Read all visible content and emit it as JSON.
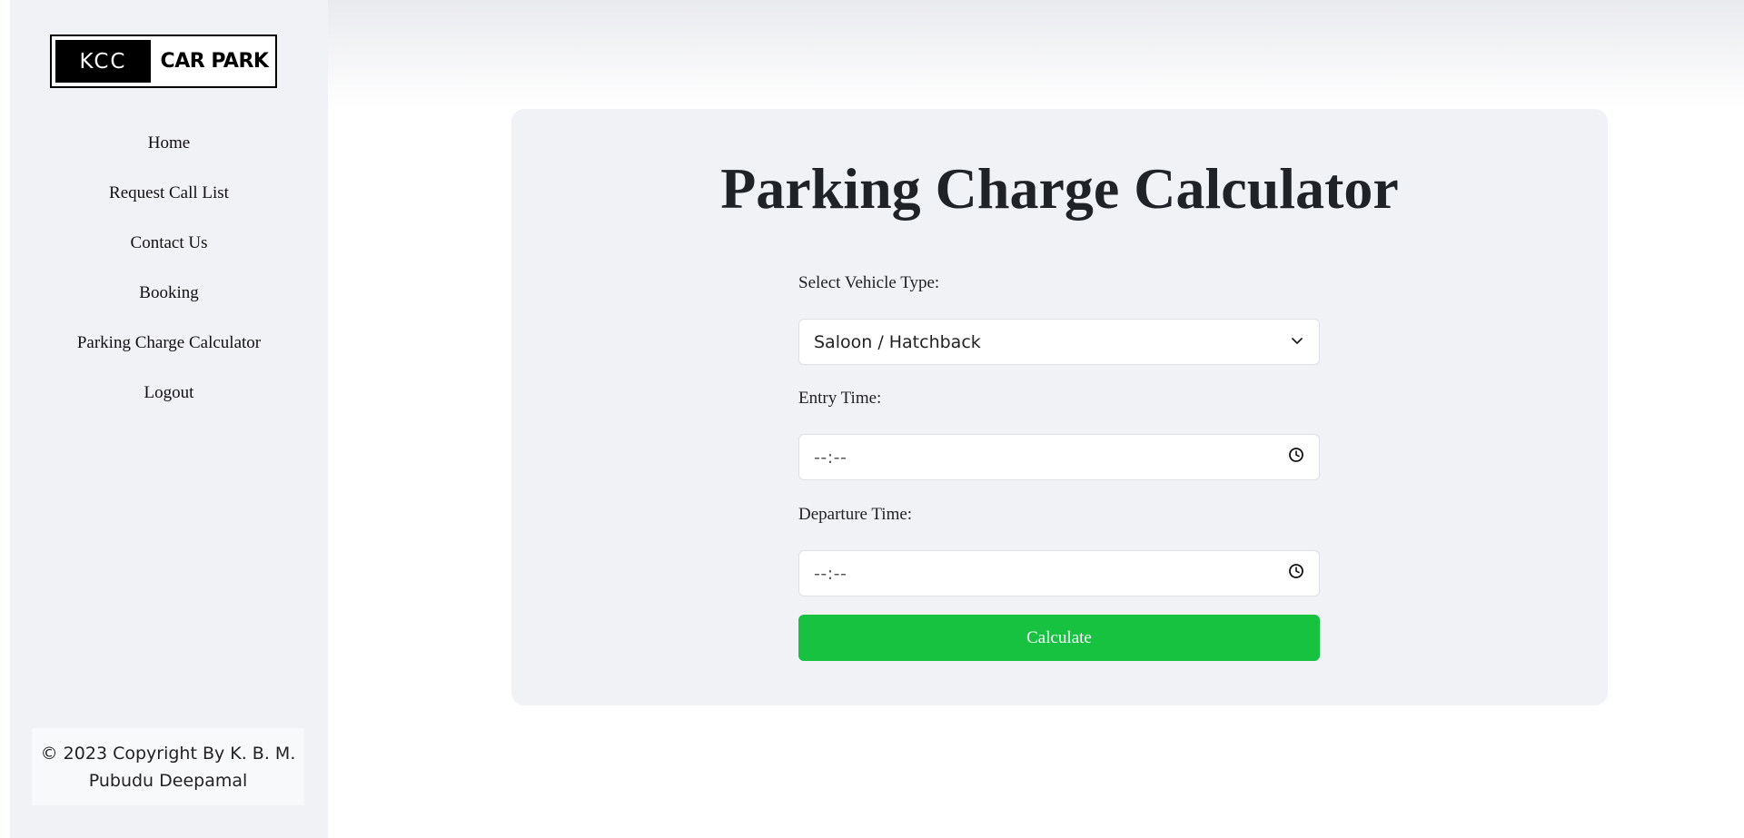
{
  "sidebar": {
    "logo": {
      "left_text": "KCC",
      "right_text": "CAR PARK"
    },
    "nav_items": [
      {
        "label": "Home"
      },
      {
        "label": "Request Call List"
      },
      {
        "label": "Contact Us"
      },
      {
        "label": "Booking"
      },
      {
        "label": "Parking Charge Calculator"
      },
      {
        "label": "Logout"
      }
    ],
    "footer": {
      "line1": "© 2023 Copyright By K. B. M.",
      "line2": "Pubudu Deepamal"
    }
  },
  "main": {
    "title": "Parking Charge Calculator",
    "vehicle_type": {
      "label": "Select Vehicle Type:",
      "selected": "Saloon / Hatchback",
      "icon": "chevron-down-icon"
    },
    "entry_time": {
      "label": "Entry Time:",
      "value": "--:--",
      "icon": "clock-icon"
    },
    "departure_time": {
      "label": "Departure Time:",
      "value": "--:--",
      "icon": "clock-icon"
    },
    "calculate_label": "Calculate"
  },
  "colors": {
    "sidebar_bg": "#f1f2f6",
    "card_bg": "#f0f2f6",
    "button_green": "#16c240"
  }
}
